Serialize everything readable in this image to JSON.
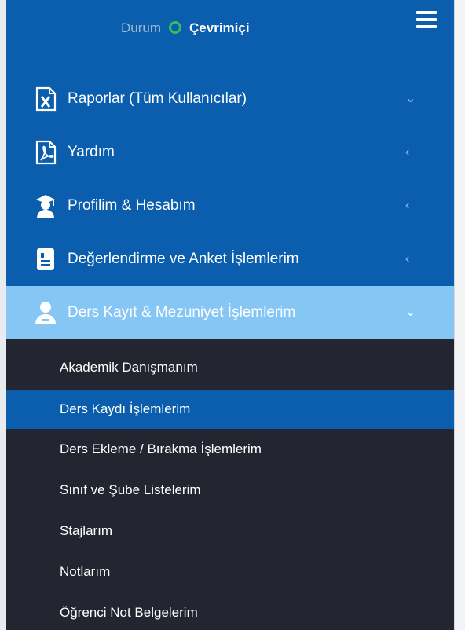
{
  "status": {
    "label": "Durum",
    "value": "Çevrimiçi",
    "color": "#2fbf5b"
  },
  "menu": [
    {
      "label": "Raporlar (Tüm Kullanıcılar)",
      "icon": "excel-file-icon",
      "chevron": "⌄",
      "expanded": true
    },
    {
      "label": "Yardım",
      "icon": "pdf-file-icon",
      "chevron": "‹",
      "expanded": false
    },
    {
      "label": "Profilim & Hesabım",
      "icon": "graduate-icon",
      "chevron": "‹",
      "expanded": false
    },
    {
      "label": "Değerlendirme ve Anket İşlemlerim",
      "icon": "survey-icon",
      "chevron": "‹",
      "expanded": false
    },
    {
      "label": "Ders Kayıt & Mezuniyet İşlemlerim",
      "icon": "student-icon",
      "chevron": "⌄",
      "expanded": true,
      "active": true
    }
  ],
  "submenu": [
    {
      "label": "Akademik Danışmanım"
    },
    {
      "label": "Ders Kaydı İşlemlerim",
      "active": true
    },
    {
      "label": "Ders Ekleme / Bırakma İşlemlerim"
    },
    {
      "label": "Sınıf ve Şube Listelerim"
    },
    {
      "label": "Stajlarım"
    },
    {
      "label": "Notlarım"
    },
    {
      "label": "Öğrenci Not Belgelerim"
    }
  ],
  "colors": {
    "sidebar": "#0a5ead",
    "active_menu": "#86c6f5",
    "submenu_bg": "#232631",
    "active_sub": "#0a5ead"
  }
}
